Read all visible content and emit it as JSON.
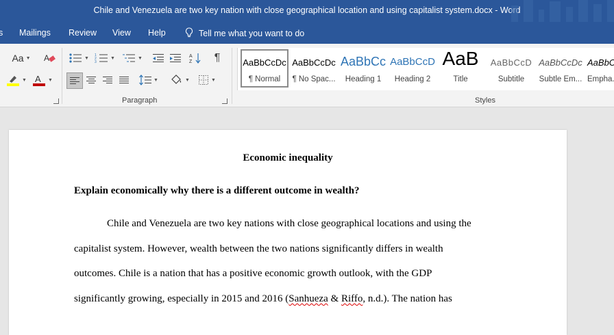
{
  "window": {
    "title": "Chile and Venezuela are two key nation with close geographical location and using capitalist system.docx  -  Word"
  },
  "menu": {
    "tabs": [
      "Mailings",
      "Review",
      "View",
      "Help"
    ],
    "tell_me": "Tell me what you want to do"
  },
  "ribbon": {
    "font_group": {
      "change_case_label": "Aa"
    },
    "paragraph_group_label": "Paragraph",
    "styles_group_label": "Styles",
    "styles": [
      {
        "preview": "AaBbCcDc",
        "name": "¶ Normal"
      },
      {
        "preview": "AaBbCcDc",
        "name": "¶ No Spac..."
      },
      {
        "preview": "AaBbCc",
        "name": "Heading 1"
      },
      {
        "preview": "AaBbCcD",
        "name": "Heading 2"
      },
      {
        "preview": "AaB",
        "name": "Title"
      },
      {
        "preview": "AaBbCcD",
        "name": "Subtitle"
      },
      {
        "preview": "AaBbCcDc",
        "name": "Subtle Em..."
      },
      {
        "preview": "AaBbCcDc",
        "name": "Empha..."
      }
    ],
    "colors": {
      "highlight": "#ffff00",
      "font_color": "#c00000",
      "title_bar": "#2b579a",
      "heading_blue": "#2e74b5"
    }
  },
  "document": {
    "title": "Economic inequality",
    "question": "Explain economically why there is a different outcome in wealth?",
    "lines": [
      "Chile and Venezuela are two key nations with close geographical locations and using the",
      "capitalist system. However, wealth between the two nations significantly differs in wealth",
      "outcomes. Chile is a nation that has a positive economic growth outlook, with the GDP"
    ],
    "last_line": {
      "before": "significantly growing, especially in 2015 and 2016 (",
      "author1": "Sanhueza",
      "mid": " & ",
      "author2": "Riffo",
      "after": ", n.d.). The nation has"
    }
  }
}
